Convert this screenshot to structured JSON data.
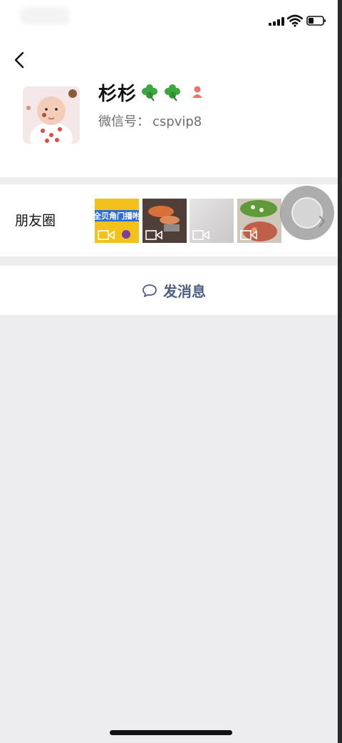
{
  "profile": {
    "name": "杉杉",
    "wechat_id_label": "微信号：",
    "wechat_id": "cspvip8"
  },
  "moments": {
    "label": "朋友圈",
    "thumbnails": [
      {
        "type": "video",
        "caption": "全贝角门播咐"
      },
      {
        "type": "video"
      },
      {
        "type": "video"
      },
      {
        "type": "video"
      }
    ]
  },
  "actions": {
    "send_message": "发消息"
  },
  "icons": {
    "back": "back-icon",
    "clover": "clover-icon",
    "gender": "female-icon",
    "chat": "chat-bubble-icon",
    "video": "video-icon",
    "chevron": "chevron-right-icon"
  },
  "colors": {
    "accent_link": "#4c5e86",
    "gender_female": "#e8766e",
    "clover_green": "#3aa83e",
    "background": "#edecee"
  }
}
